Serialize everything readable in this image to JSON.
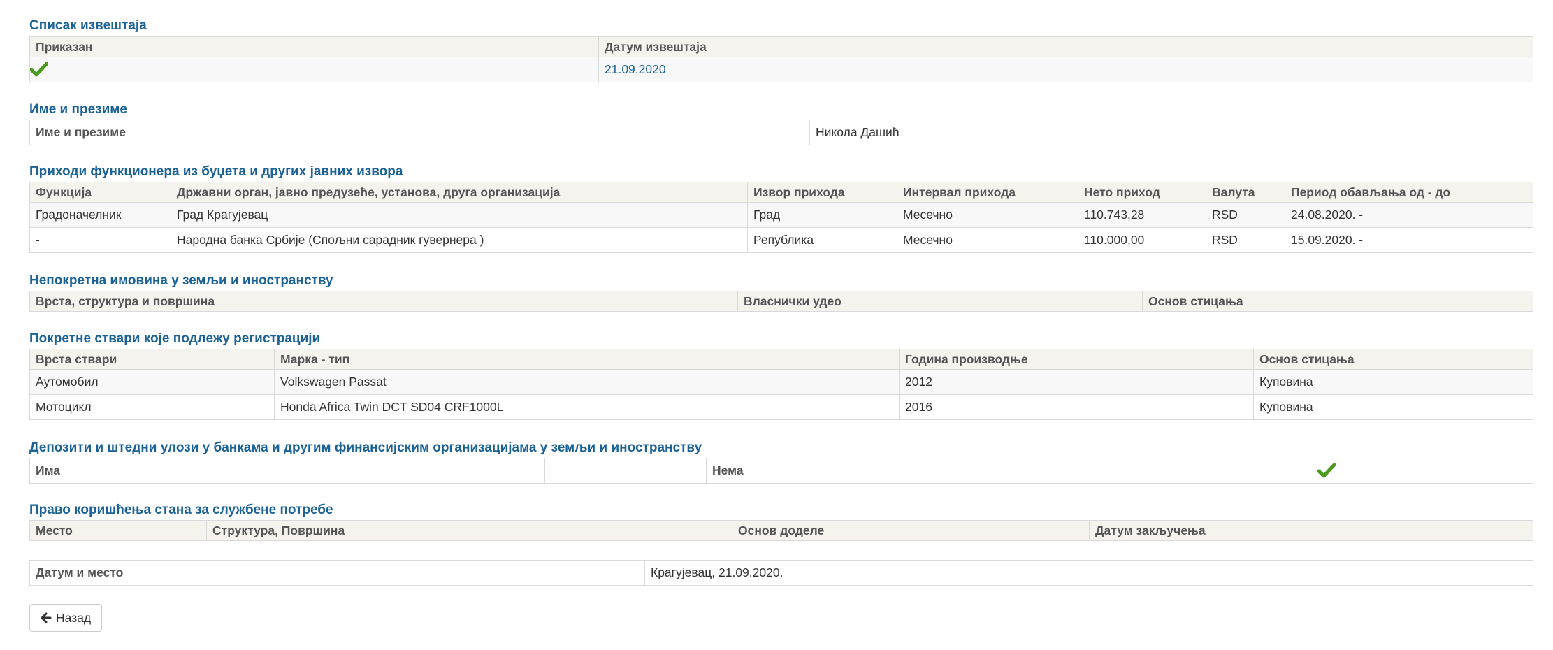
{
  "reports": {
    "title": "Списак извештаја",
    "col_shown": "Приказан",
    "col_date": "Датум извештаја",
    "shown_icon": "check-icon",
    "date_value": "21.09.2020"
  },
  "name": {
    "title": "Име и презиме",
    "label": "Име и презиме",
    "value": "Никола Дашић"
  },
  "income": {
    "title": "Приходи функционера из буџета и других јавних извора",
    "headers": [
      "Функција",
      "Државни орган, јавно предузеће, установа, друга организација",
      "Извор прихода",
      "Интервал прихода",
      "Нето приход",
      "Валута",
      "Период обављања од - до"
    ],
    "rows": [
      [
        "Градоначелник",
        "Град Крагујевац",
        "Град",
        "Месечно",
        "110.743,28",
        "RSD",
        "24.08.2020. -"
      ],
      [
        "-",
        "Народна банка Србије (Спољни сарадник гувернера )",
        "Република",
        "Месечно",
        "110.000,00",
        "RSD",
        "15.09.2020. -"
      ]
    ]
  },
  "realestate": {
    "title": "Непокретна имовина у земљи и иностранству",
    "headers": [
      "Врста, структура и површина",
      "Власнички удео",
      "Основ стицања"
    ]
  },
  "vehicles": {
    "title": "Покретне ствари које подлежу регистрацији",
    "headers": [
      "Врста ствари",
      "Марка - тип",
      "Година производње",
      "Основ стицања"
    ],
    "rows": [
      [
        "Аутомобил",
        "Volkswagen Passat",
        "2012",
        "Куповина"
      ],
      [
        "Мотоцикл",
        "Honda Africa Twin DCT SD04 CRF1000L",
        "2016",
        "Куповина"
      ]
    ]
  },
  "deposits": {
    "title": "Депозити и штедни улози у банкама и другим финансијским организацијама у земљи и иностранству",
    "has_label": "Има",
    "none_label": "Нема",
    "none_icon": "check-icon"
  },
  "apartment": {
    "title": "Право коришћења стана за службене потребе",
    "headers": [
      "Место",
      "Структура, Површина",
      "Основ доделе",
      "Датум закључења"
    ]
  },
  "footer": {
    "label": "Датум и место",
    "value": "Крагујевац, 21.09.2020."
  },
  "back_button": {
    "label": "Назад",
    "icon": "arrow-left-icon"
  },
  "colors": {
    "title": "#1b6296",
    "header_bg": "#f5f3ee",
    "check": "#4a9a1c"
  }
}
